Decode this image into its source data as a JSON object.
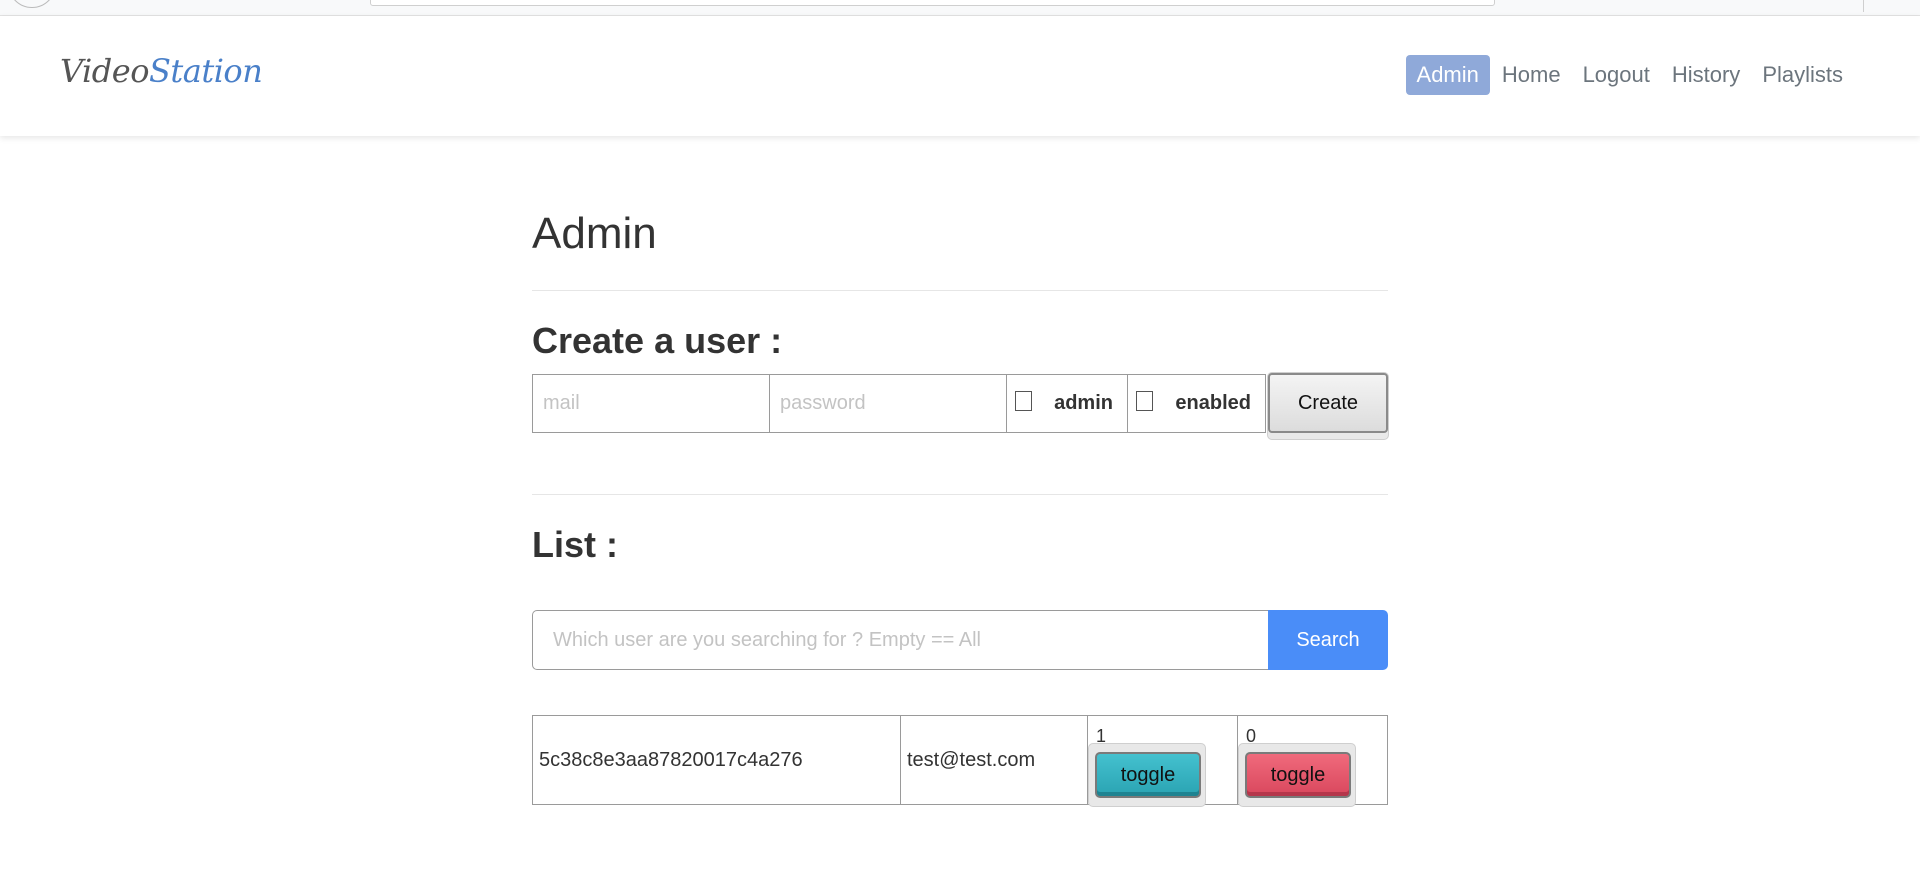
{
  "navbar": {
    "brand_part1": "Video",
    "brand_part2": "Station",
    "items": [
      {
        "label": "Admin",
        "active": true
      },
      {
        "label": "Home",
        "active": false
      },
      {
        "label": "Logout",
        "active": false
      },
      {
        "label": "History",
        "active": false
      },
      {
        "label": "Playlists",
        "active": false
      }
    ]
  },
  "page": {
    "title": "Admin"
  },
  "create_user": {
    "title": "Create a user :",
    "mail_placeholder": "mail",
    "password_placeholder": "password",
    "admin_label": "admin",
    "admin_checked": false,
    "enabled_label": "enabled",
    "enabled_checked": false,
    "create_label": "Create"
  },
  "list": {
    "title": "List :",
    "search_placeholder": "Which user are you searching for ? Empty == All",
    "search_value": "",
    "search_label": "Search"
  },
  "users": [
    {
      "id": "5c38c8e3aa87820017c4a276",
      "mail": "test@test.com",
      "admin": "1",
      "admin_toggle_label": "toggle",
      "enabled": "0",
      "enabled_toggle_label": "toggle"
    }
  ],
  "colors": {
    "brand_accent": "#4a80c9",
    "nav_active_bg": "#8fa9d9",
    "search_button": "#4a8df8",
    "toggle_teal": "#2aa3b2",
    "toggle_red": "#d9475d"
  }
}
